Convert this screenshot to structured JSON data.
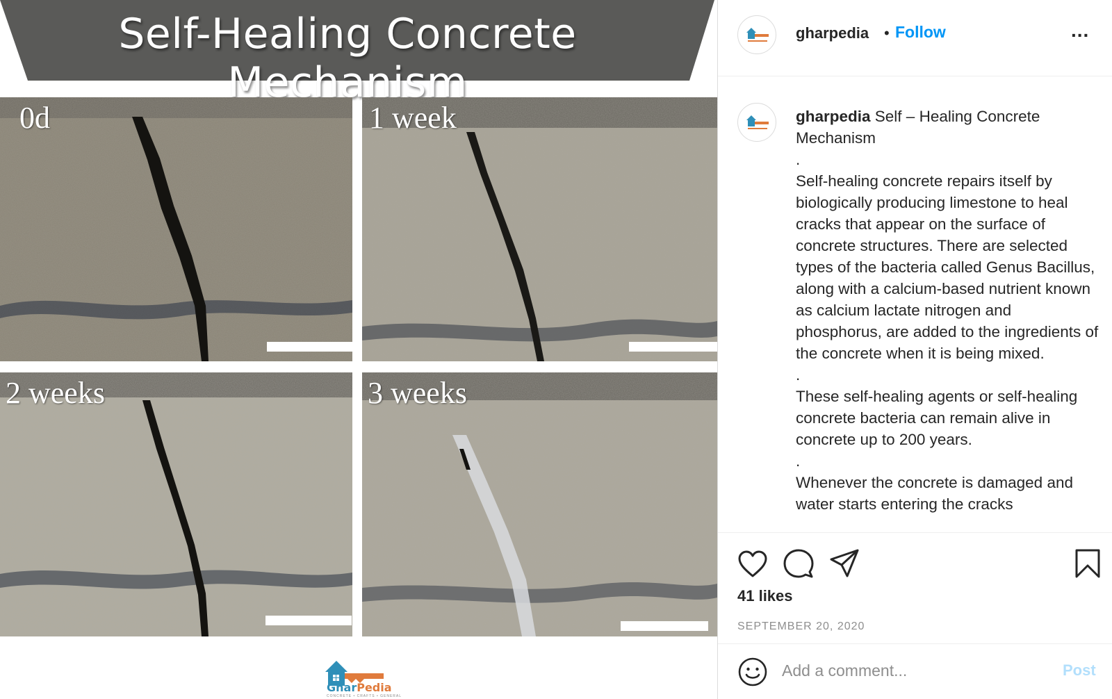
{
  "post_image": {
    "title": "Self-Healing Concrete Mechanism",
    "panels": [
      {
        "label": "0d"
      },
      {
        "label": "1 week"
      },
      {
        "label": "2 weeks"
      },
      {
        "label": "3 weeks"
      }
    ],
    "logo_text_a": "Ghar",
    "logo_text_b": "Pedia",
    "logo_subtitle": "CONCRETE • CRAFTS • GENERAL"
  },
  "header": {
    "username": "gharpedia",
    "separator": "•",
    "follow_label": "Follow",
    "more_label": "..."
  },
  "caption": {
    "username": "gharpedia",
    "text": " Self – Healing Concrete Mechanism\n.\nSelf-healing concrete repairs itself by biologically producing limestone to heal cracks that appear on the surface of concrete structures. There are selected types of the bacteria called Genus Bacillus, along with a calcium-based nutrient known as calcium lactate nitrogen and phosphorus, are added to the ingredients of the concrete when it is being mixed.\n.\nThese self-healing agents or self-healing concrete bacteria can remain alive in concrete up to 200 years.\n.\nWhenever the concrete is damaged and water starts entering the cracks"
  },
  "actions": {
    "icons": [
      "heart-icon",
      "comment-icon",
      "share-icon",
      "bookmark-icon"
    ],
    "likes": "41 likes",
    "date": "SEPTEMBER 20, 2020"
  },
  "comment": {
    "placeholder": "Add a comment...",
    "post_label": "Post"
  },
  "colors": {
    "accent": "#0095f6",
    "post_disabled": "#b2dffc",
    "banner": "#5a5a58"
  }
}
